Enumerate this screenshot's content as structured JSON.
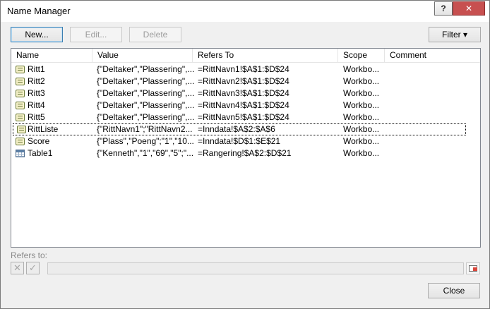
{
  "window": {
    "title": "Name Manager",
    "help_label": "?",
    "close_label": "✕"
  },
  "toolbar": {
    "new_label": "New...",
    "edit_label": "Edit...",
    "delete_label": "Delete",
    "filter_label": "Filter ▾"
  },
  "list": {
    "columns": [
      "Name",
      "Value",
      "Refers To",
      "Scope",
      "Comment"
    ],
    "rows": [
      {
        "icon": "name-icon",
        "name": "Ritt1",
        "value": "{\"Deltaker\",\"Plassering\",...",
        "refers_to": "=RittNavn1!$A$1:$D$24",
        "scope": "Workbo...",
        "comment": ""
      },
      {
        "icon": "name-icon",
        "name": "Ritt2",
        "value": "{\"Deltaker\",\"Plassering\",...",
        "refers_to": "=RittNavn2!$A$1:$D$24",
        "scope": "Workbo...",
        "comment": ""
      },
      {
        "icon": "name-icon",
        "name": "Ritt3",
        "value": "{\"Deltaker\",\"Plassering\",...",
        "refers_to": "=RittNavn3!$A$1:$D$24",
        "scope": "Workbo...",
        "comment": ""
      },
      {
        "icon": "name-icon",
        "name": "Ritt4",
        "value": "{\"Deltaker\",\"Plassering\",...",
        "refers_to": "=RittNavn4!$A$1:$D$24",
        "scope": "Workbo...",
        "comment": ""
      },
      {
        "icon": "name-icon",
        "name": "Ritt5",
        "value": "{\"Deltaker\",\"Plassering\",...",
        "refers_to": "=RittNavn5!$A$1:$D$24",
        "scope": "Workbo...",
        "comment": ""
      },
      {
        "icon": "name-icon",
        "name": "RittListe",
        "value": "{\"RittNavn1\";\"RittNavn2...",
        "refers_to": "=Inndata!$A$2:$A$6",
        "scope": "Workbo...",
        "comment": ""
      },
      {
        "icon": "name-icon",
        "name": "Score",
        "value": "{\"Plass\",\"Poeng\";\"1\",\"10...",
        "refers_to": "=Inndata!$D$1:$E$21",
        "scope": "Workbo...",
        "comment": ""
      },
      {
        "icon": "table-icon",
        "name": "Table1",
        "value": "{\"Kenneth\",\"1\",\"69\",\"5\";\"...",
        "refers_to": "=Rangering!$A$2:$D$21",
        "scope": "Workbo...",
        "comment": ""
      }
    ]
  },
  "refers": {
    "label": "Refers to:",
    "value": "",
    "cancel_icon": "✕",
    "confirm_icon": "✓"
  },
  "footer": {
    "close_label": "Close"
  }
}
